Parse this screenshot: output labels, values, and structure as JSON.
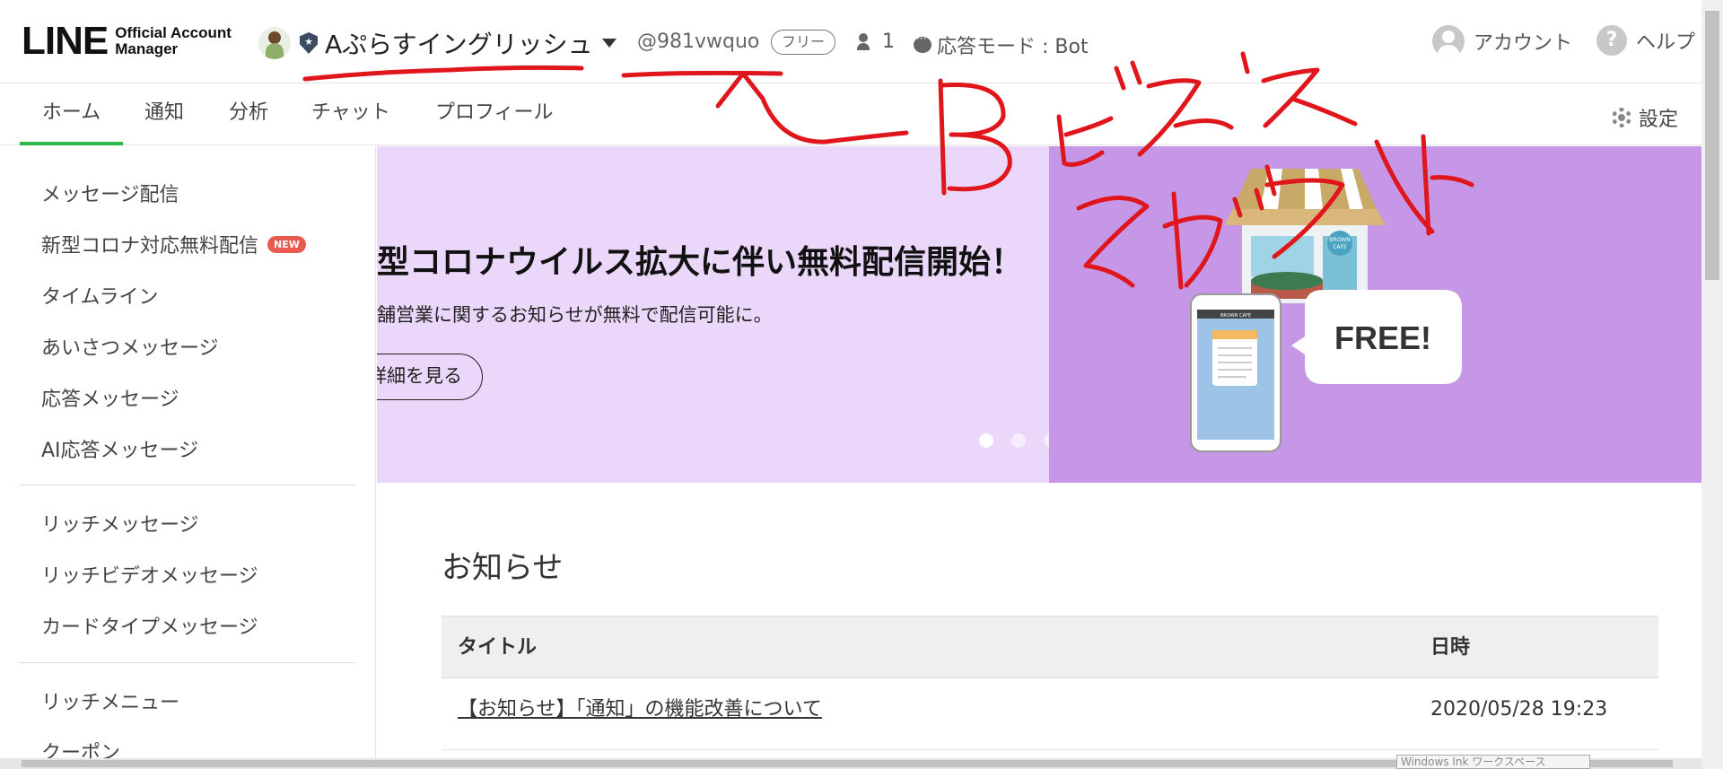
{
  "header": {
    "logo_main": "LINE",
    "logo_sub": "Official Account Manager",
    "account_name": "Aぷらすイングリッシュ",
    "account_id": "@981vwquo",
    "plan_badge": "フリー",
    "friends_count": "1",
    "response_mode": "応答モード : Bot",
    "account_link": "アカウント",
    "help_link": "ヘルプ",
    "icons": [
      "avatar",
      "shield-icon",
      "chevron-down-icon",
      "people-icon",
      "chat-bubble-icon",
      "user-icon",
      "help-icon"
    ]
  },
  "tabs": [
    {
      "label": "ホーム",
      "active": true
    },
    {
      "label": "通知",
      "active": false
    },
    {
      "label": "分析",
      "active": false
    },
    {
      "label": "チャット",
      "active": false
    },
    {
      "label": "プロフィール",
      "active": false
    }
  ],
  "settings_label": "設定",
  "sidebar": {
    "items": [
      {
        "label": "メッセージ配信"
      },
      {
        "label": "新型コロナ対応無料配信",
        "badge": "NEW"
      },
      {
        "label": "タイムライン"
      },
      {
        "label": "あいさつメッセージ"
      },
      {
        "label": "応答メッセージ"
      },
      {
        "label": "AI応答メッセージ"
      },
      {
        "label": "リッチメッセージ"
      },
      {
        "label": "リッチビデオメッセージ"
      },
      {
        "label": "カードタイプメッセージ"
      },
      {
        "label": "リッチメニュー"
      },
      {
        "label": "クーポン"
      }
    ]
  },
  "banner": {
    "title": "型コロナウイルス拡大に伴い無料配信開始！",
    "subtitle": "舗営業に関するお知らせが無料で配信可能に。",
    "button": "詳細を見る",
    "illustration_text": "FREE!",
    "shop_sign": "BROWN CAFE",
    "phone_header": "BROWN CAFE",
    "slide_count": 5,
    "active_slide": 1,
    "colors": {
      "left_bg": "#ead7f9",
      "right_bg": "#c597e6"
    }
  },
  "notices": {
    "section_title": "お知らせ",
    "columns": [
      "タイトル",
      "日時"
    ],
    "rows": [
      {
        "title": "【お知らせ】「通知」の機能改善について",
        "date": "2020/05/28 19:23"
      }
    ]
  },
  "overlay": {
    "ink_tooltip": "Windows Ink ワークスペース",
    "annotation_color": "#e0161d",
    "annotation_text": "B ビジネスアカウント"
  },
  "colors": {
    "accent": "#2eb84b",
    "new_badge": "#e85a4f"
  }
}
